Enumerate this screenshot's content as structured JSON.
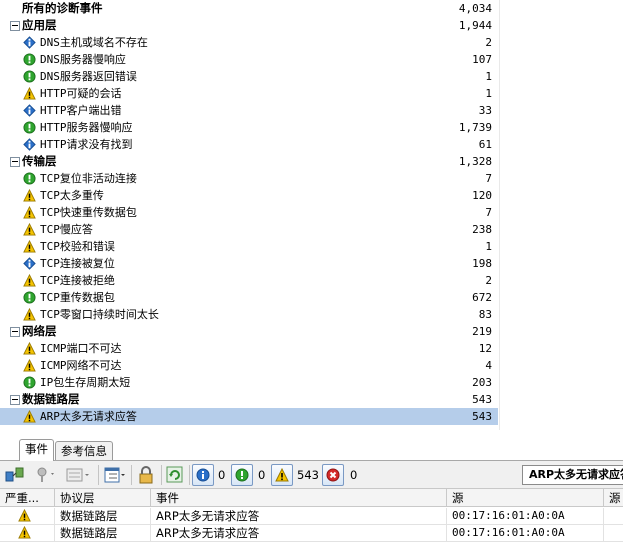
{
  "tree": {
    "root": {
      "label": "所有的诊断事件",
      "count": "4,034"
    },
    "groups": [
      {
        "label": "应用层",
        "count": "1,944",
        "items": [
          {
            "icon": "info-icon",
            "label": "DNS主机或域名不存在",
            "count": "2"
          },
          {
            "icon": "ok-icon",
            "label": "DNS服务器慢响应",
            "count": "107"
          },
          {
            "icon": "ok-icon",
            "label": "DNS服务器返回错误",
            "count": "1"
          },
          {
            "icon": "warning-icon",
            "label": "HTTP可疑的会话",
            "count": "1"
          },
          {
            "icon": "info-icon",
            "label": "HTTP客户端出错",
            "count": "33"
          },
          {
            "icon": "ok-icon",
            "label": "HTTP服务器慢响应",
            "count": "1,739"
          },
          {
            "icon": "info-icon",
            "label": "HTTP请求没有找到",
            "count": "61"
          }
        ]
      },
      {
        "label": "传输层",
        "count": "1,328",
        "items": [
          {
            "icon": "ok-icon",
            "label": "TCP复位非活动连接",
            "count": "7"
          },
          {
            "icon": "warning-icon",
            "label": "TCP太多重传",
            "count": "120"
          },
          {
            "icon": "warning-icon",
            "label": "TCP快速重传数据包",
            "count": "7"
          },
          {
            "icon": "warning-icon",
            "label": "TCP慢应答",
            "count": "238"
          },
          {
            "icon": "warning-icon",
            "label": "TCP校验和错误",
            "count": "1"
          },
          {
            "icon": "info-icon",
            "label": "TCP连接被复位",
            "count": "198"
          },
          {
            "icon": "warning-icon",
            "label": "TCP连接被拒绝",
            "count": "2"
          },
          {
            "icon": "ok-icon",
            "label": "TCP重传数据包",
            "count": "672"
          },
          {
            "icon": "warning-icon",
            "label": "TCP零窗口持续时间太长",
            "count": "83"
          }
        ]
      },
      {
        "label": "网络层",
        "count": "219",
        "items": [
          {
            "icon": "warning-icon",
            "label": "ICMP端口不可达",
            "count": "12"
          },
          {
            "icon": "warning-icon",
            "label": "ICMP网络不可达",
            "count": "4"
          },
          {
            "icon": "ok-icon",
            "label": "IP包生存周期太短",
            "count": "203"
          }
        ]
      },
      {
        "label": "数据链路层",
        "count": "543",
        "items": [
          {
            "icon": "warning-icon",
            "label": "ARP太多无请求应答",
            "count": "543",
            "selected": true
          }
        ]
      }
    ]
  },
  "tabs": [
    {
      "label": "事件",
      "active": true
    },
    {
      "label": "参考信息",
      "active": false
    }
  ],
  "toolbar": {
    "info_count": "0",
    "ok_count": "0",
    "warning_count": "543",
    "error_count": "0",
    "event_name": "ARP太多无请求应答"
  },
  "grid": {
    "headers": [
      "严重...",
      "协议层",
      "事件",
      "源",
      "源"
    ],
    "rows": [
      {
        "severity": "warning-icon",
        "layer": "数据链路层",
        "event": "ARP太多无请求应答",
        "source": "00:17:16:01:A0:0A"
      },
      {
        "severity": "warning-icon",
        "layer": "数据链路层",
        "event": "ARP太多无请求应答",
        "source": "00:17:16:01:A0:0A"
      }
    ]
  },
  "colors": {
    "selection": "#b5cdea",
    "warning": "#f5c400",
    "ok": "#2fa52f",
    "info": "#2a6fc9",
    "error": "#d42a2a"
  }
}
